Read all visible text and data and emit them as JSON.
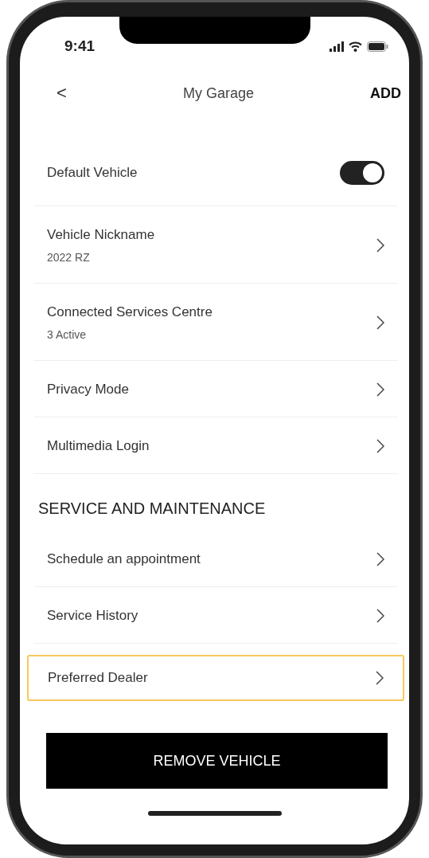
{
  "status_bar": {
    "time": "9:41"
  },
  "header": {
    "back": "<",
    "title": "My Garage",
    "action": "ADD"
  },
  "sections": [
    {
      "rows": [
        {
          "kind": "toggle",
          "label": "Default Vehicle",
          "on": true,
          "highlighted": false
        },
        {
          "kind": "link",
          "label": "Vehicle Nickname",
          "subtitle": "2022 RZ",
          "highlighted": false
        },
        {
          "kind": "link",
          "label": "Connected Services Centre",
          "subtitle": "3 Active",
          "highlighted": false
        },
        {
          "kind": "link",
          "label": "Privacy Mode",
          "highlighted": false
        },
        {
          "kind": "link",
          "label": "Multimedia Login",
          "highlighted": false
        }
      ]
    },
    {
      "heading": "SERVICE AND MAINTENANCE",
      "rows": [
        {
          "kind": "link",
          "label": "Schedule an appointment",
          "highlighted": false
        },
        {
          "kind": "link",
          "label": "Service History",
          "highlighted": false
        },
        {
          "kind": "link",
          "label": "Preferred Dealer",
          "highlighted": true
        }
      ]
    }
  ],
  "button": "REMOVE VEHICLE"
}
